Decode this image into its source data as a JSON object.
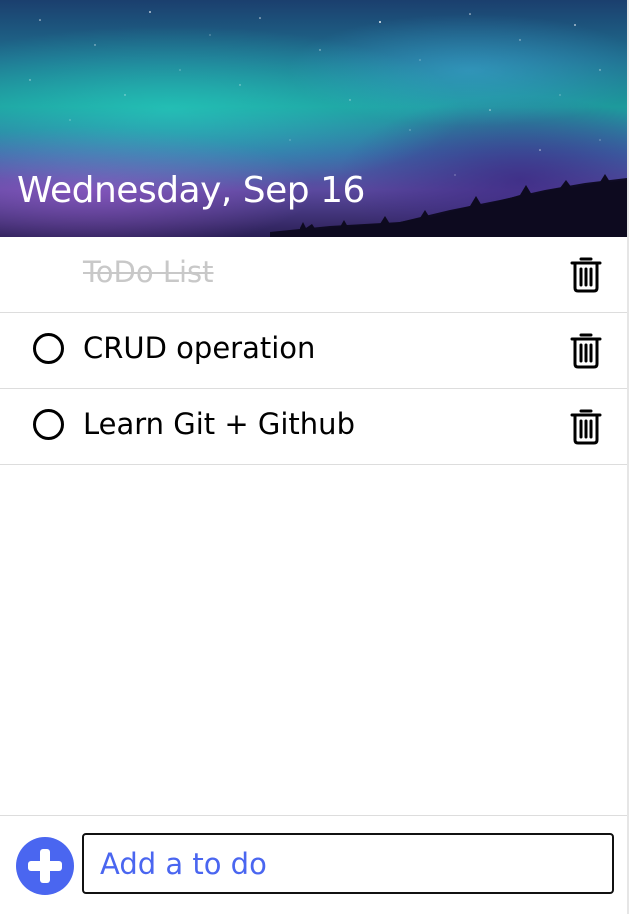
{
  "header": {
    "date": "Wednesday, Sep 16"
  },
  "todos": [
    {
      "text": "ToDo List",
      "completed": true
    },
    {
      "text": "CRUD operation",
      "completed": false
    },
    {
      "text": "Learn Git + Github",
      "completed": false
    }
  ],
  "icons": {
    "check": "circle-outline-icon",
    "delete": "trash-icon",
    "add": "plus-circle-icon"
  },
  "add_input": {
    "placeholder": "Add a to do",
    "value": ""
  },
  "colors": {
    "accent": "#4a66f0",
    "completed_text": "#c8c8c8"
  }
}
